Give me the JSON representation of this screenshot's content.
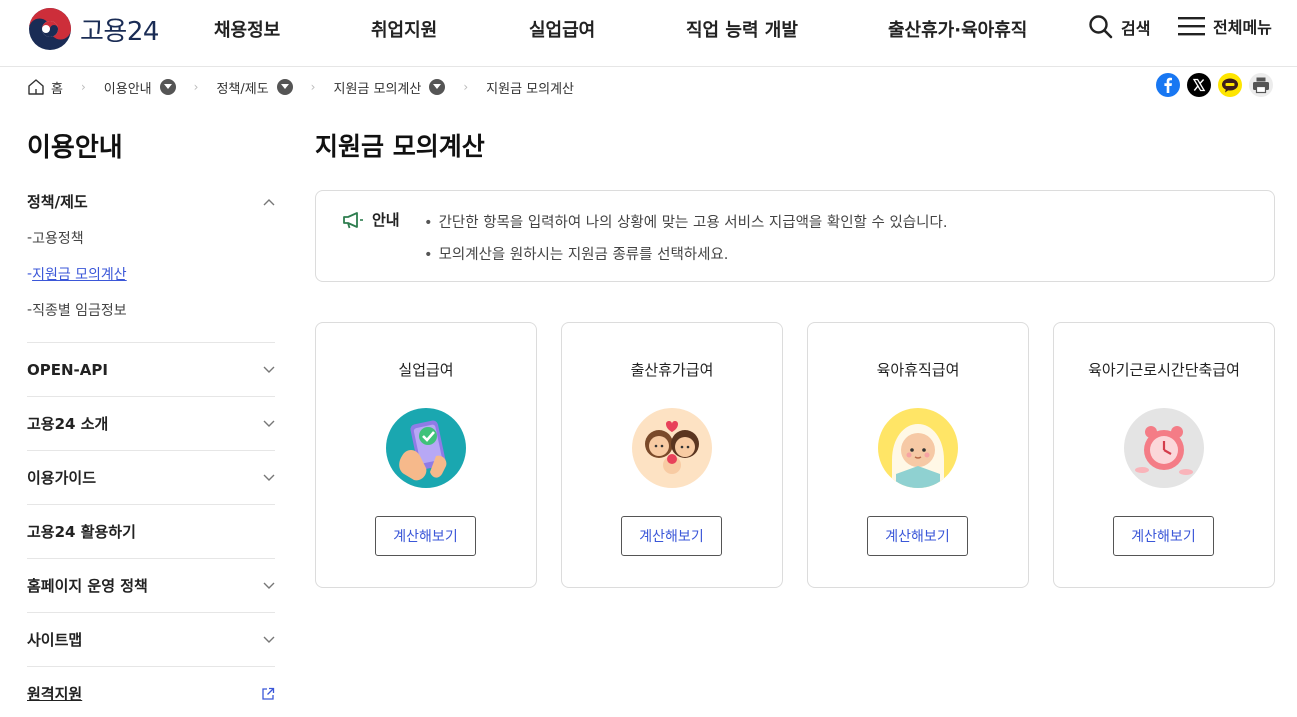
{
  "header": {
    "logo_text": "고용24",
    "nav": [
      "채용정보",
      "취업지원",
      "실업급여",
      "직업 능력 개발",
      "출산휴가·육아휴직"
    ],
    "search_label": "검색",
    "menu_label": "전체메뉴"
  },
  "breadcrumb": {
    "home": "홈",
    "items": [
      "이용안내",
      "정책/제도",
      "지원금 모의계산"
    ],
    "current": "지원금 모의계산"
  },
  "share": {
    "icons": [
      "facebook-icon",
      "x-icon",
      "kakaotalk-icon",
      "print-icon"
    ],
    "colors": {
      "facebook": "#1877f2",
      "x": "#000000",
      "kakao": "#fee500"
    }
  },
  "sidebar": {
    "title": "이용안내",
    "groups": [
      {
        "label": "정책/제도",
        "expanded": true,
        "sub": [
          "고용정책",
          "지원금 모의계산",
          "직종별 임금정보"
        ],
        "active_sub": "지원금 모의계산"
      },
      {
        "label": "OPEN-API"
      },
      {
        "label": "고용24 소개"
      },
      {
        "label": "이용가이드"
      },
      {
        "label": "고용24 활용하기"
      },
      {
        "label": "홈페이지 운영 정책"
      },
      {
        "label": "사이트맵"
      },
      {
        "label": "원격지원",
        "external": true
      }
    ]
  },
  "main": {
    "title": "지원금 모의계산",
    "notice": {
      "label": "안내",
      "lines": [
        "간단한 항목을 입력하여 나의 상황에 맞는 고용 서비스 지급액을 확인할 수 있습니다.",
        "모의계산을 원하시는 지원금 종류를 선택하세요."
      ]
    },
    "cards": [
      {
        "title": "실업급여",
        "button": "계산해보기",
        "icon": "phone-check-icon"
      },
      {
        "title": "출산휴가급여",
        "button": "계산해보기",
        "icon": "family-icon"
      },
      {
        "title": "육아휴직급여",
        "button": "계산해보기",
        "icon": "baby-icon"
      },
      {
        "title": "육아기근로시간단축급여",
        "button": "계산해보기",
        "icon": "alarm-clock-icon"
      }
    ]
  },
  "colors": {
    "accent": "#3b57d8",
    "brand_navy": "#1a2c55",
    "brand_red": "#cd2e3a",
    "border": "#dcdcdc"
  }
}
